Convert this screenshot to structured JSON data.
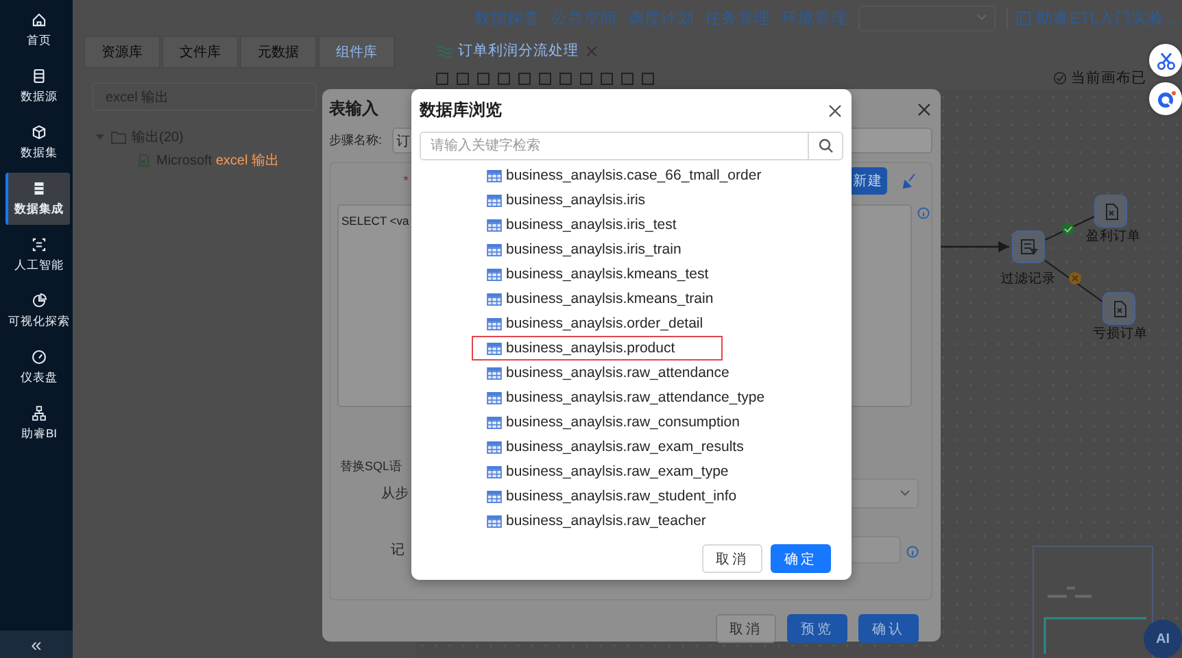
{
  "sidebar": {
    "items": [
      {
        "label": "首页",
        "selected": false
      },
      {
        "label": "数据源",
        "selected": false
      },
      {
        "label": "数据集",
        "selected": false
      },
      {
        "label": "数据集成",
        "selected": true
      },
      {
        "label": "人工智能",
        "selected": false
      },
      {
        "label": "可视化探索",
        "selected": false
      },
      {
        "label": "仪表盘",
        "selected": false
      },
      {
        "label": "助睿BI",
        "selected": false
      }
    ],
    "collapse": "«"
  },
  "topbar": {
    "nav": [
      "数据探查",
      "公共空间",
      "调度计划",
      "任务管理",
      "环境管理"
    ],
    "project": "助睿ETL入门实验 ..."
  },
  "left_panel": {
    "tabs": [
      {
        "label": "资源库",
        "selected": false
      },
      {
        "label": "文件库",
        "selected": false
      },
      {
        "label": "元数据",
        "selected": false
      },
      {
        "label": "组件库",
        "selected": true
      }
    ],
    "search": "excel 输出",
    "tree": [
      {
        "label": "输出(20)",
        "expanded": true,
        "children": [
          {
            "prefix": "Microsoft ",
            "match": "excel 输出"
          }
        ]
      }
    ]
  },
  "editor": {
    "tab": "订单利润分流处理",
    "save_status": "当前画布已",
    "nodes": [
      {
        "label": "过滤记录",
        "kind": "filter"
      },
      {
        "label": "盈利订单",
        "kind": "output"
      },
      {
        "label": "亏损订单",
        "kind": "output"
      }
    ]
  },
  "table_input_dialog": {
    "title": "表输入",
    "step_name_label": "步骤名称:",
    "step_name": "订",
    "required_mark": "*",
    "new_button": "新建",
    "sql": "SELECT <va",
    "replace_sql_label": "替换SQL语",
    "from_step_label": "从步",
    "record_label": "记",
    "buttons": [
      {
        "label": "取消",
        "kind": "default"
      },
      {
        "label": "预览",
        "kind": "primary"
      },
      {
        "label": "确认",
        "kind": "primary"
      }
    ]
  },
  "db_browser_dialog": {
    "title": "数据库浏览",
    "search_placeholder": "请输入关键字检索",
    "tables": [
      {
        "name": "business_anaylsis.case_66_tmall_order",
        "selected": false
      },
      {
        "name": "business_anaylsis.iris",
        "selected": false
      },
      {
        "name": "business_anaylsis.iris_test",
        "selected": false
      },
      {
        "name": "business_anaylsis.iris_train",
        "selected": false
      },
      {
        "name": "business_anaylsis.kmeans_test",
        "selected": false
      },
      {
        "name": "business_anaylsis.kmeans_train",
        "selected": false
      },
      {
        "name": "business_anaylsis.order_detail",
        "selected": false
      },
      {
        "name": "business_anaylsis.product",
        "selected": true
      },
      {
        "name": "business_anaylsis.raw_attendance",
        "selected": false
      },
      {
        "name": "business_anaylsis.raw_attendance_type",
        "selected": false
      },
      {
        "name": "business_anaylsis.raw_consumption",
        "selected": false
      },
      {
        "name": "business_anaylsis.raw_exam_results",
        "selected": false
      },
      {
        "name": "business_anaylsis.raw_exam_type",
        "selected": false
      },
      {
        "name": "business_anaylsis.raw_student_info",
        "selected": false
      },
      {
        "name": "business_anaylsis.raw_teacher",
        "selected": false
      }
    ],
    "buttons": [
      {
        "label": "取消",
        "kind": "default"
      },
      {
        "label": "确定",
        "kind": "primary"
      }
    ]
  },
  "ai_button": "AI"
}
